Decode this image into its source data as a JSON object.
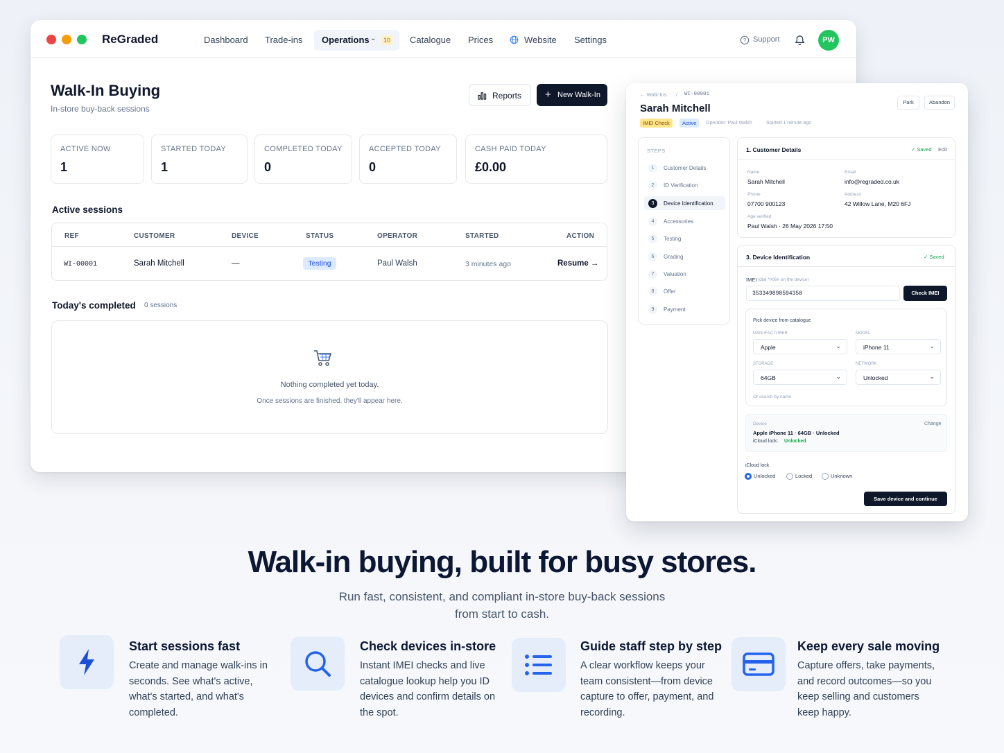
{
  "app": {
    "brand": "ReGraded",
    "nav": [
      "Dashboard",
      "Trade-ins",
      "Operations",
      "Catalogue",
      "Prices",
      "Website",
      "Settings"
    ],
    "operations_badge": "10",
    "support": "Support",
    "avatar_initials": "PW"
  },
  "page": {
    "title": "Walk-In Buying",
    "subtitle": "In-store buy-back sessions",
    "reports_label": "Reports",
    "new_label": "New Walk-In"
  },
  "stats": [
    {
      "label": "ACTIVE NOW",
      "value": "1"
    },
    {
      "label": "STARTED TODAY",
      "value": "1"
    },
    {
      "label": "COMPLETED TODAY",
      "value": "0"
    },
    {
      "label": "ACCEPTED TODAY",
      "value": "0"
    },
    {
      "label": "CASH PAID TODAY",
      "value": "£0.00"
    }
  ],
  "active_sessions": {
    "title": "Active sessions",
    "columns": [
      "REF",
      "CUSTOMER",
      "DEVICE",
      "STATUS",
      "OPERATOR",
      "STARTED",
      "ACTION"
    ],
    "rows": [
      {
        "ref": "WI-00001",
        "customer": "Sarah Mitchell",
        "device": "—",
        "status": "Testing",
        "operator": "Paul Walsh",
        "started": "3 minutes ago",
        "action": "Resume →"
      }
    ]
  },
  "completed": {
    "title": "Today's completed",
    "count": "0 sessions",
    "empty_title": "Nothing completed yet today.",
    "empty_sub": "Once sessions are finished, they'll appear here."
  },
  "wizard": {
    "crumb_parent": "← Walk-Ins",
    "crumb_sep": "/",
    "crumb_ref": "WI-00001",
    "customer": "Sarah Mitchell",
    "tag_stage": "IMEI Check",
    "tag_state": "Active",
    "operator": "Operator: Paul Walsh",
    "started": "Started 1 minute ago",
    "park": "Park",
    "abandon": "Abandon",
    "steps_title": "STEPS",
    "steps": [
      {
        "n": "1",
        "label": "Customer Details"
      },
      {
        "n": "2",
        "label": "ID Verification"
      },
      {
        "n": "3",
        "label": "Device Identification"
      },
      {
        "n": "4",
        "label": "Accessories"
      },
      {
        "n": "5",
        "label": "Testing"
      },
      {
        "n": "6",
        "label": "Grading"
      },
      {
        "n": "7",
        "label": "Valuation"
      },
      {
        "n": "8",
        "label": "Offer"
      },
      {
        "n": "9",
        "label": "Payment"
      }
    ],
    "customer_card": {
      "title": "1. Customer Details",
      "saved": "✓ Saved",
      "edit": "Edit",
      "name_label": "Name",
      "name": "Sarah Mitchell",
      "email_label": "Email",
      "email": "info@regraded.co.uk",
      "phone_label": "Phone",
      "phone": "07700 900123",
      "address_label": "Address",
      "address": "42 Willow Lane, M20 6FJ",
      "age_label": "Age verified",
      "age": "Paul Walsh · 26 May 2026 17:50"
    },
    "device_card": {
      "title": "3. Device Identification",
      "saved": "✓ Saved",
      "imei_label": "IMEI",
      "imei_hint": "(dial *#06# on the device)",
      "imei_value": "353349898594358",
      "check_imei": "Check IMEI",
      "pick_title": "Pick device from catalogue",
      "manufacturer_label": "MANUFACTURER",
      "manufacturer": "Apple",
      "model_label": "MODEL",
      "model": "iPhone 11",
      "storage_label": "STORAGE",
      "storage": "64GB",
      "network_label": "NETWORK",
      "network": "Unlocked",
      "search_hint": "Or search by name",
      "device_label": "Device",
      "device_value": "Apple iPhone 11 · 64GB · Unlocked",
      "icloud_line_label": "iCloud lock:",
      "icloud_line_value": "Unlocked",
      "change": "Change",
      "icloud_title": "iCloud lock",
      "icloud_options": [
        "Unlocked",
        "Locked",
        "Unknown"
      ],
      "icloud_selected": "Unlocked",
      "save_continue": "Save device and continue"
    }
  },
  "marketing": {
    "headline": "Walk-in buying, built for busy stores.",
    "tagline": "Run fast, consistent, and compliant in-store buy-back sessions from start to cash.",
    "features": [
      {
        "icon": "lightning-icon",
        "title": "Start sessions fast",
        "body": "Create and manage walk-ins in seconds. See what's active, what's started, and what's completed."
      },
      {
        "icon": "search-icon",
        "title": "Check devices in-store",
        "body": "Instant IMEI checks and live catalogue lookup help you ID devices and confirm details on the spot."
      },
      {
        "icon": "list-icon",
        "title": "Guide staff step by step",
        "body": "A clear workflow keeps your team consistent—from device capture to offer, payment, and recording."
      },
      {
        "icon": "card-icon",
        "title": "Keep every sale moving",
        "body": "Capture offers, take payments, and record outcomes—so you keep selling and customers keep happy."
      }
    ]
  },
  "colors": {
    "navy": "#0f172a",
    "accent_blue": "#2563eb",
    "green": "#22c55e",
    "amber_tag": "#fde68a",
    "blue_tag": "#dbeafe"
  }
}
